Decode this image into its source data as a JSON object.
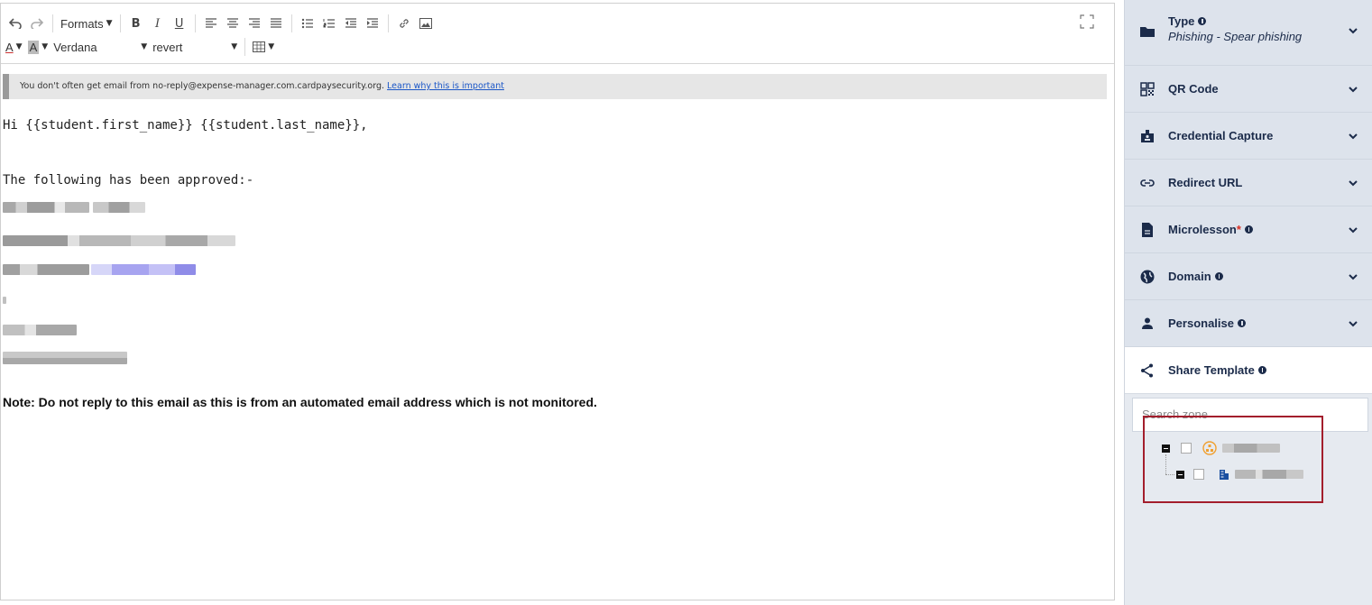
{
  "toolbar": {
    "formats_label": "Formats",
    "font_family": "Verdana",
    "font_size": "revert",
    "text_color_letter": "A",
    "bg_color_letter": "A",
    "bold": "B",
    "italic": "I",
    "underline": "U"
  },
  "editor": {
    "warning_text": "You don't often get email from no-reply@expense-manager.com.cardpaysecurity.org.",
    "warning_link": "Learn why this is important",
    "greeting": "Hi {{student.first_name}} {{student.last_name}},",
    "approved_line": "The following has been approved:-",
    "note": "Note: Do not reply to this email as this is from an automated email address which is not monitored."
  },
  "panel": {
    "type": {
      "title": "Type",
      "value": "Phishing - Spear phishing"
    },
    "sections": [
      {
        "title": "QR Code",
        "icon": "qr-code-icon"
      },
      {
        "title": "Credential Capture",
        "icon": "id-badge-icon"
      },
      {
        "title": "Redirect URL",
        "icon": "link-icon"
      },
      {
        "title": "Microlesson",
        "icon": "document-icon",
        "required": "*"
      },
      {
        "title": "Domain",
        "icon": "globe-icon"
      },
      {
        "title": "Personalise",
        "icon": "person-icon"
      }
    ],
    "share": {
      "title": "Share Template"
    },
    "search_placeholder": "Search zone"
  },
  "colors": {
    "panel_bg": "#dde3ec",
    "navy": "#1b2b4a",
    "highlight": "#a31e2c",
    "org_orange": "#f0a030",
    "link_blue": "#1a56c7"
  }
}
